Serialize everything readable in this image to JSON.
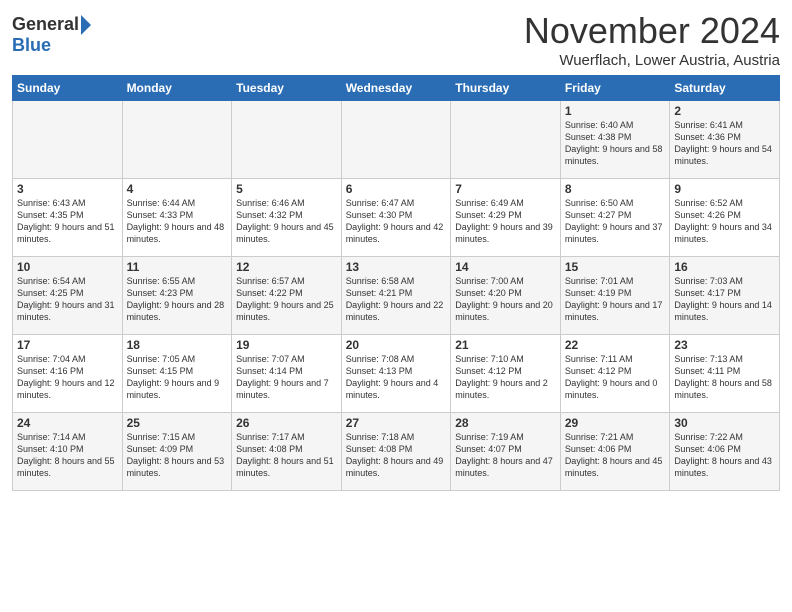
{
  "header": {
    "logo_general": "General",
    "logo_blue": "Blue",
    "month_title": "November 2024",
    "subtitle": "Wuerflach, Lower Austria, Austria"
  },
  "days_of_week": [
    "Sunday",
    "Monday",
    "Tuesday",
    "Wednesday",
    "Thursday",
    "Friday",
    "Saturday"
  ],
  "weeks": [
    [
      {
        "day": "",
        "info": ""
      },
      {
        "day": "",
        "info": ""
      },
      {
        "day": "",
        "info": ""
      },
      {
        "day": "",
        "info": ""
      },
      {
        "day": "",
        "info": ""
      },
      {
        "day": "1",
        "info": "Sunrise: 6:40 AM\nSunset: 4:38 PM\nDaylight: 9 hours\nand 58 minutes."
      },
      {
        "day": "2",
        "info": "Sunrise: 6:41 AM\nSunset: 4:36 PM\nDaylight: 9 hours\nand 54 minutes."
      }
    ],
    [
      {
        "day": "3",
        "info": "Sunrise: 6:43 AM\nSunset: 4:35 PM\nDaylight: 9 hours\nand 51 minutes."
      },
      {
        "day": "4",
        "info": "Sunrise: 6:44 AM\nSunset: 4:33 PM\nDaylight: 9 hours\nand 48 minutes."
      },
      {
        "day": "5",
        "info": "Sunrise: 6:46 AM\nSunset: 4:32 PM\nDaylight: 9 hours\nand 45 minutes."
      },
      {
        "day": "6",
        "info": "Sunrise: 6:47 AM\nSunset: 4:30 PM\nDaylight: 9 hours\nand 42 minutes."
      },
      {
        "day": "7",
        "info": "Sunrise: 6:49 AM\nSunset: 4:29 PM\nDaylight: 9 hours\nand 39 minutes."
      },
      {
        "day": "8",
        "info": "Sunrise: 6:50 AM\nSunset: 4:27 PM\nDaylight: 9 hours\nand 37 minutes."
      },
      {
        "day": "9",
        "info": "Sunrise: 6:52 AM\nSunset: 4:26 PM\nDaylight: 9 hours\nand 34 minutes."
      }
    ],
    [
      {
        "day": "10",
        "info": "Sunrise: 6:54 AM\nSunset: 4:25 PM\nDaylight: 9 hours\nand 31 minutes."
      },
      {
        "day": "11",
        "info": "Sunrise: 6:55 AM\nSunset: 4:23 PM\nDaylight: 9 hours\nand 28 minutes."
      },
      {
        "day": "12",
        "info": "Sunrise: 6:57 AM\nSunset: 4:22 PM\nDaylight: 9 hours\nand 25 minutes."
      },
      {
        "day": "13",
        "info": "Sunrise: 6:58 AM\nSunset: 4:21 PM\nDaylight: 9 hours\nand 22 minutes."
      },
      {
        "day": "14",
        "info": "Sunrise: 7:00 AM\nSunset: 4:20 PM\nDaylight: 9 hours\nand 20 minutes."
      },
      {
        "day": "15",
        "info": "Sunrise: 7:01 AM\nSunset: 4:19 PM\nDaylight: 9 hours\nand 17 minutes."
      },
      {
        "day": "16",
        "info": "Sunrise: 7:03 AM\nSunset: 4:17 PM\nDaylight: 9 hours\nand 14 minutes."
      }
    ],
    [
      {
        "day": "17",
        "info": "Sunrise: 7:04 AM\nSunset: 4:16 PM\nDaylight: 9 hours\nand 12 minutes."
      },
      {
        "day": "18",
        "info": "Sunrise: 7:05 AM\nSunset: 4:15 PM\nDaylight: 9 hours\nand 9 minutes."
      },
      {
        "day": "19",
        "info": "Sunrise: 7:07 AM\nSunset: 4:14 PM\nDaylight: 9 hours\nand 7 minutes."
      },
      {
        "day": "20",
        "info": "Sunrise: 7:08 AM\nSunset: 4:13 PM\nDaylight: 9 hours\nand 4 minutes."
      },
      {
        "day": "21",
        "info": "Sunrise: 7:10 AM\nSunset: 4:12 PM\nDaylight: 9 hours\nand 2 minutes."
      },
      {
        "day": "22",
        "info": "Sunrise: 7:11 AM\nSunset: 4:12 PM\nDaylight: 9 hours\nand 0 minutes."
      },
      {
        "day": "23",
        "info": "Sunrise: 7:13 AM\nSunset: 4:11 PM\nDaylight: 8 hours\nand 58 minutes."
      }
    ],
    [
      {
        "day": "24",
        "info": "Sunrise: 7:14 AM\nSunset: 4:10 PM\nDaylight: 8 hours\nand 55 minutes."
      },
      {
        "day": "25",
        "info": "Sunrise: 7:15 AM\nSunset: 4:09 PM\nDaylight: 8 hours\nand 53 minutes."
      },
      {
        "day": "26",
        "info": "Sunrise: 7:17 AM\nSunset: 4:08 PM\nDaylight: 8 hours\nand 51 minutes."
      },
      {
        "day": "27",
        "info": "Sunrise: 7:18 AM\nSunset: 4:08 PM\nDaylight: 8 hours\nand 49 minutes."
      },
      {
        "day": "28",
        "info": "Sunrise: 7:19 AM\nSunset: 4:07 PM\nDaylight: 8 hours\nand 47 minutes."
      },
      {
        "day": "29",
        "info": "Sunrise: 7:21 AM\nSunset: 4:06 PM\nDaylight: 8 hours\nand 45 minutes."
      },
      {
        "day": "30",
        "info": "Sunrise: 7:22 AM\nSunset: 4:06 PM\nDaylight: 8 hours\nand 43 minutes."
      }
    ]
  ]
}
